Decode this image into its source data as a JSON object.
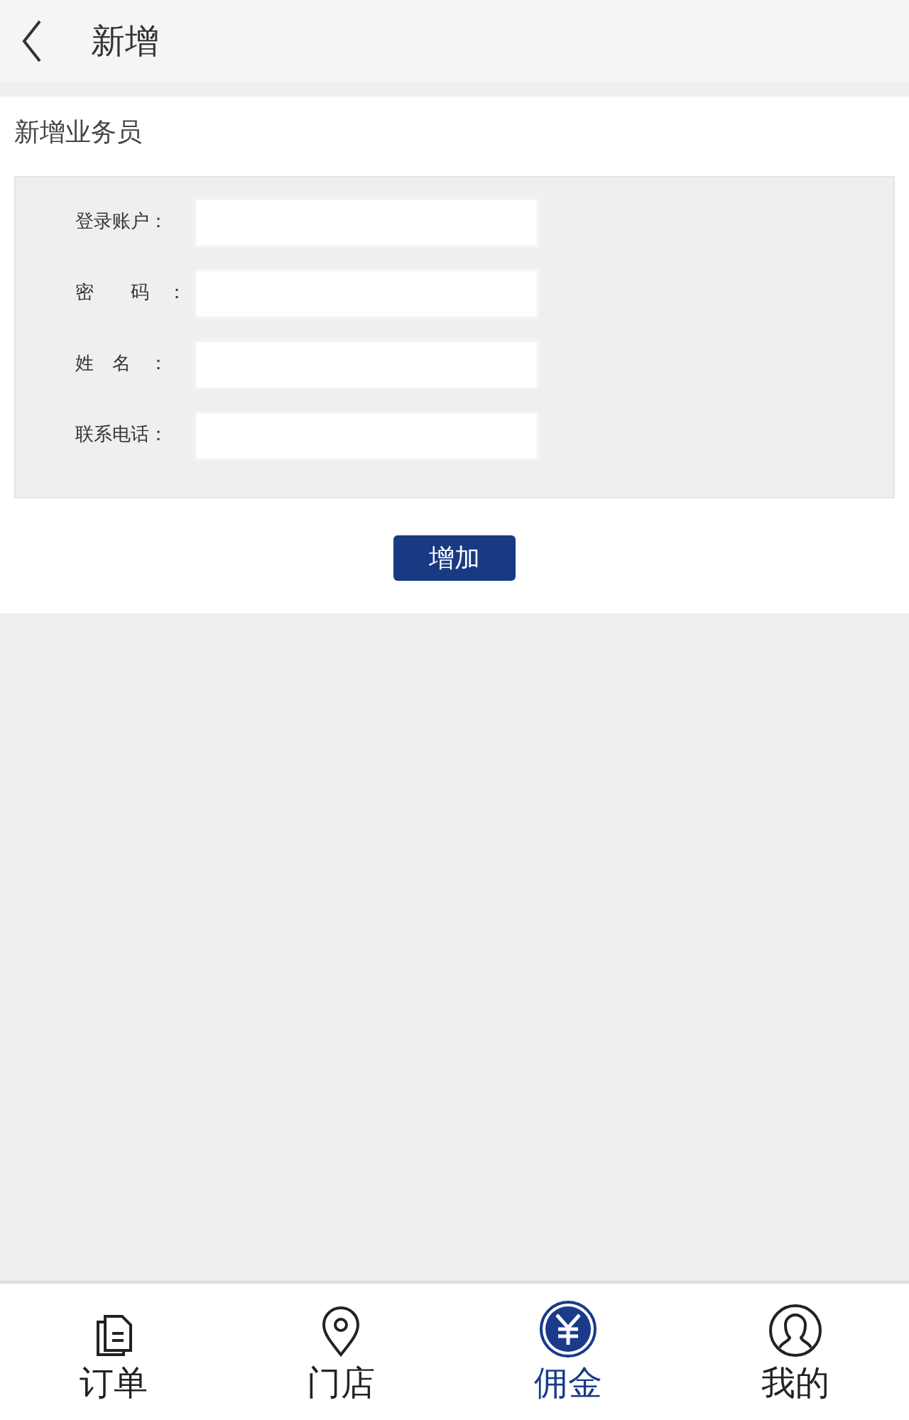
{
  "header": {
    "title": "新增"
  },
  "section": {
    "title": "新增业务员"
  },
  "form": {
    "fields": [
      {
        "label": "登录账户："
      },
      {
        "label": "密　　码　："
      },
      {
        "label": "姓　名　："
      },
      {
        "label": "联系电话："
      }
    ]
  },
  "submit": {
    "label": "增加"
  },
  "tab_bar": [
    {
      "label": "订单",
      "selected": false
    },
    {
      "label": "门店",
      "selected": false
    },
    {
      "label": "佣金",
      "selected": true
    },
    {
      "label": "我的",
      "selected": false
    }
  ]
}
